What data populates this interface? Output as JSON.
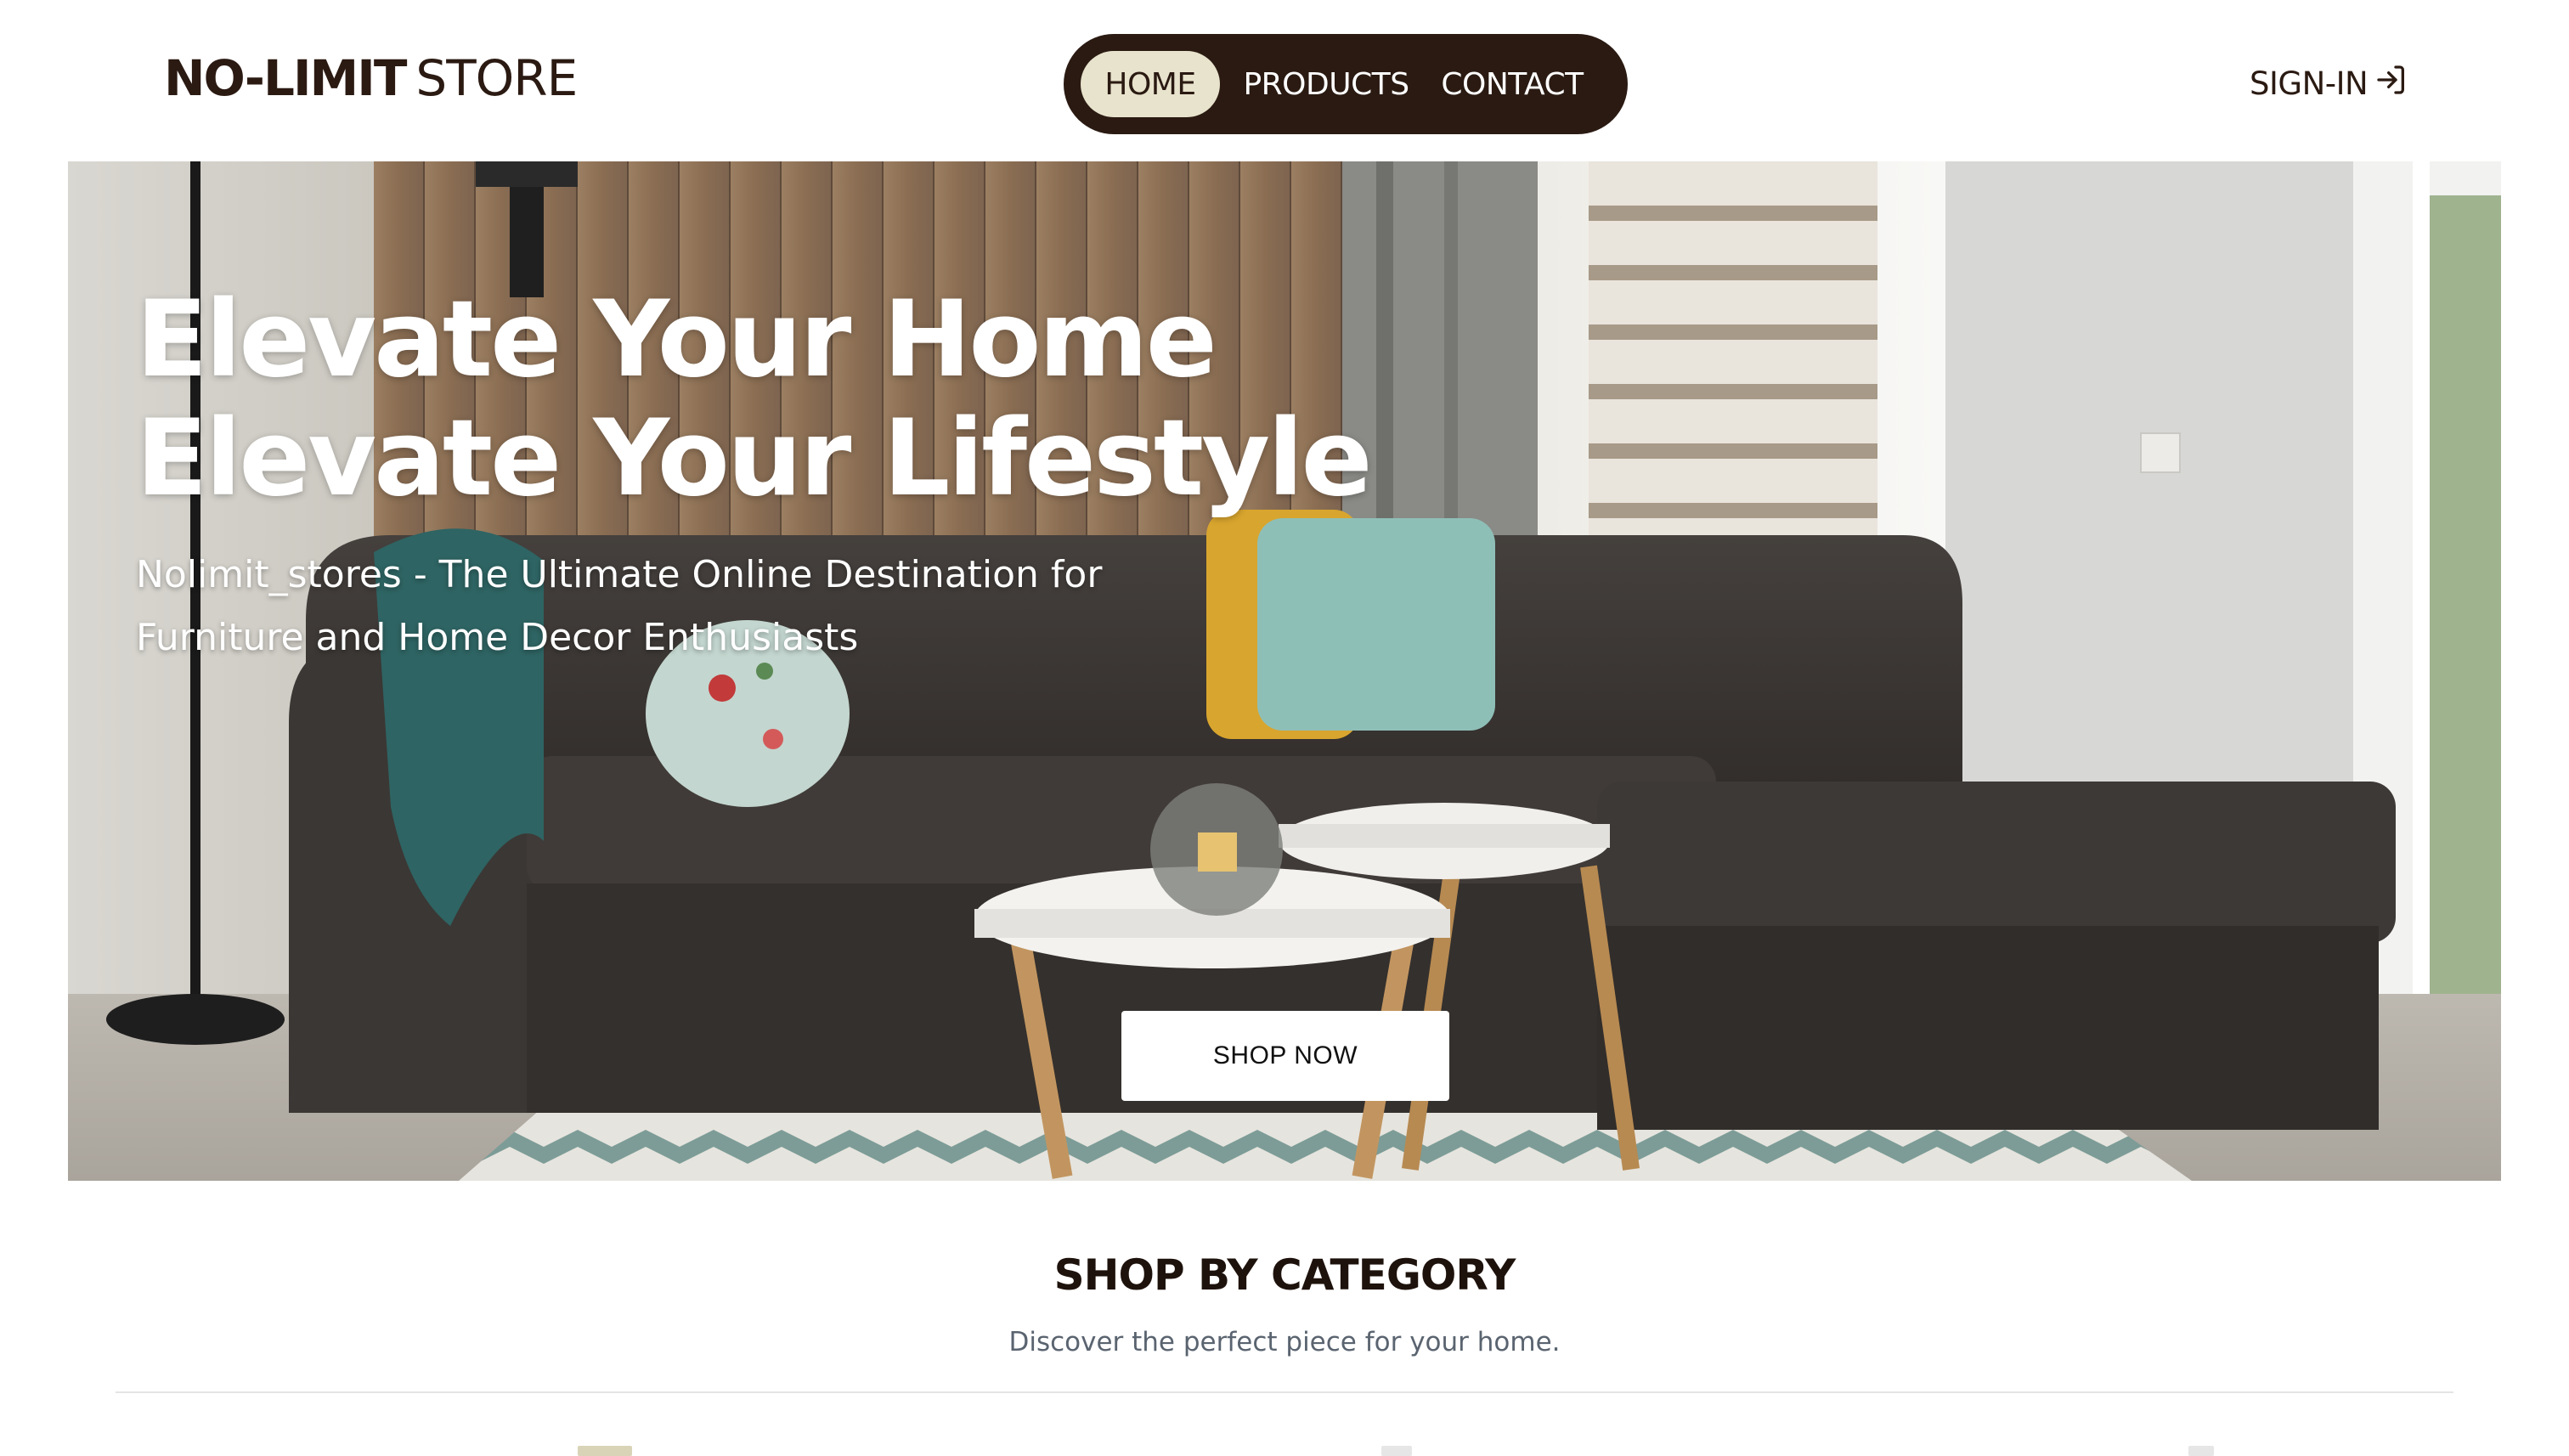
{
  "header": {
    "logo_bold": "NO-LIMIT",
    "logo_light": "STORE",
    "nav": {
      "home": "HOME",
      "products": "PRODUCTS",
      "contact": "CONTACT"
    },
    "signin_label": "SIGN-IN",
    "signin_icon": "sign-in-icon"
  },
  "hero": {
    "title_line1": "Elevate Your Home",
    "title_line2": "Elevate Your Lifestyle",
    "subtitle": "Nolimit_stores - The Ultimate Online Destination for Furniture and Home Decor Enthusiasts",
    "cta_label": "SHOP NOW"
  },
  "category": {
    "title": "SHOP BY CATEGORY",
    "subtitle": "Discover the perfect piece for your home."
  },
  "colors": {
    "brand_dark": "#2a1a12",
    "nav_active_bg": "#e8e3cc",
    "text_muted": "#5a6470"
  }
}
